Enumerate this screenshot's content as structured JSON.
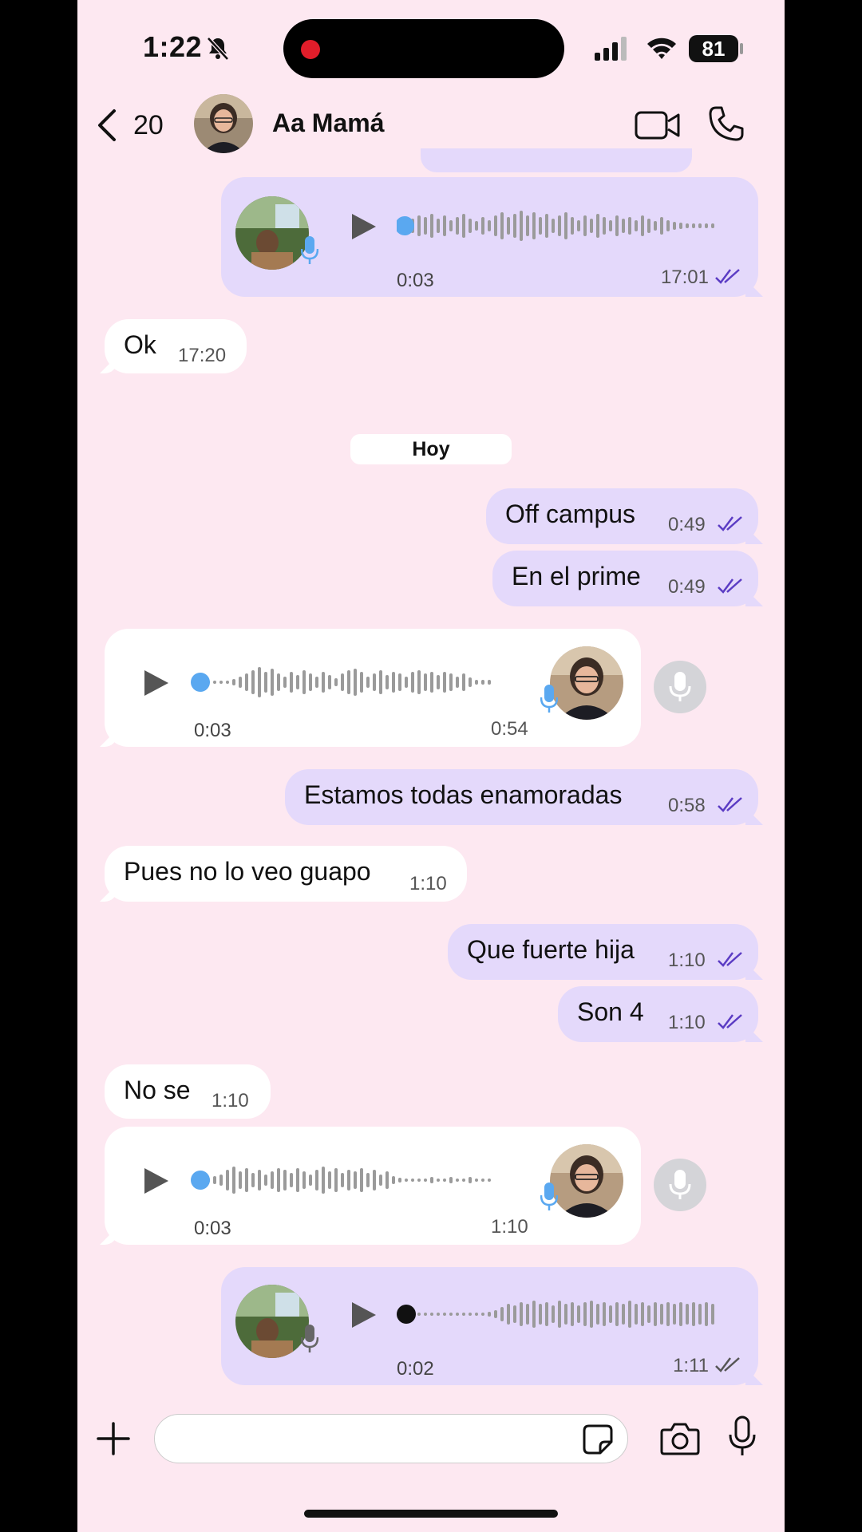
{
  "status_bar": {
    "time": "1:22",
    "battery": "81"
  },
  "header": {
    "back_count": "20",
    "contact_name": "Aa Mamá"
  },
  "date_divider": "Hoy",
  "messages": {
    "voice_out_1": {
      "duration": "0:03",
      "time": "17:01"
    },
    "ok": {
      "text": "Ok",
      "time": "17:20"
    },
    "off_campus": {
      "text": "Off campus",
      "time": "0:49"
    },
    "prime": {
      "text": "En el prime",
      "time": "0:49"
    },
    "voice_in_1": {
      "duration": "0:03",
      "time": "0:54"
    },
    "enamoradas": {
      "text": "Estamos todas enamoradas",
      "time": "0:58"
    },
    "guapo": {
      "text": "Pues no lo veo guapo",
      "time": "1:10"
    },
    "fuerte": {
      "text": "Que fuerte hija",
      "time": "1:10"
    },
    "son4": {
      "text": "Son 4",
      "time": "1:10"
    },
    "nose": {
      "text": "No se",
      "time": "1:10"
    },
    "voice_in_2": {
      "duration": "0:03",
      "time": "1:10"
    },
    "voice_out_2": {
      "duration": "0:02",
      "time": "1:11"
    }
  },
  "colors": {
    "accent": "#5b3cc4",
    "outgoing": "#e4d9fb",
    "incoming": "#ffffff",
    "background": "#fde8f1",
    "progress_dot": "#5aa8f0"
  }
}
